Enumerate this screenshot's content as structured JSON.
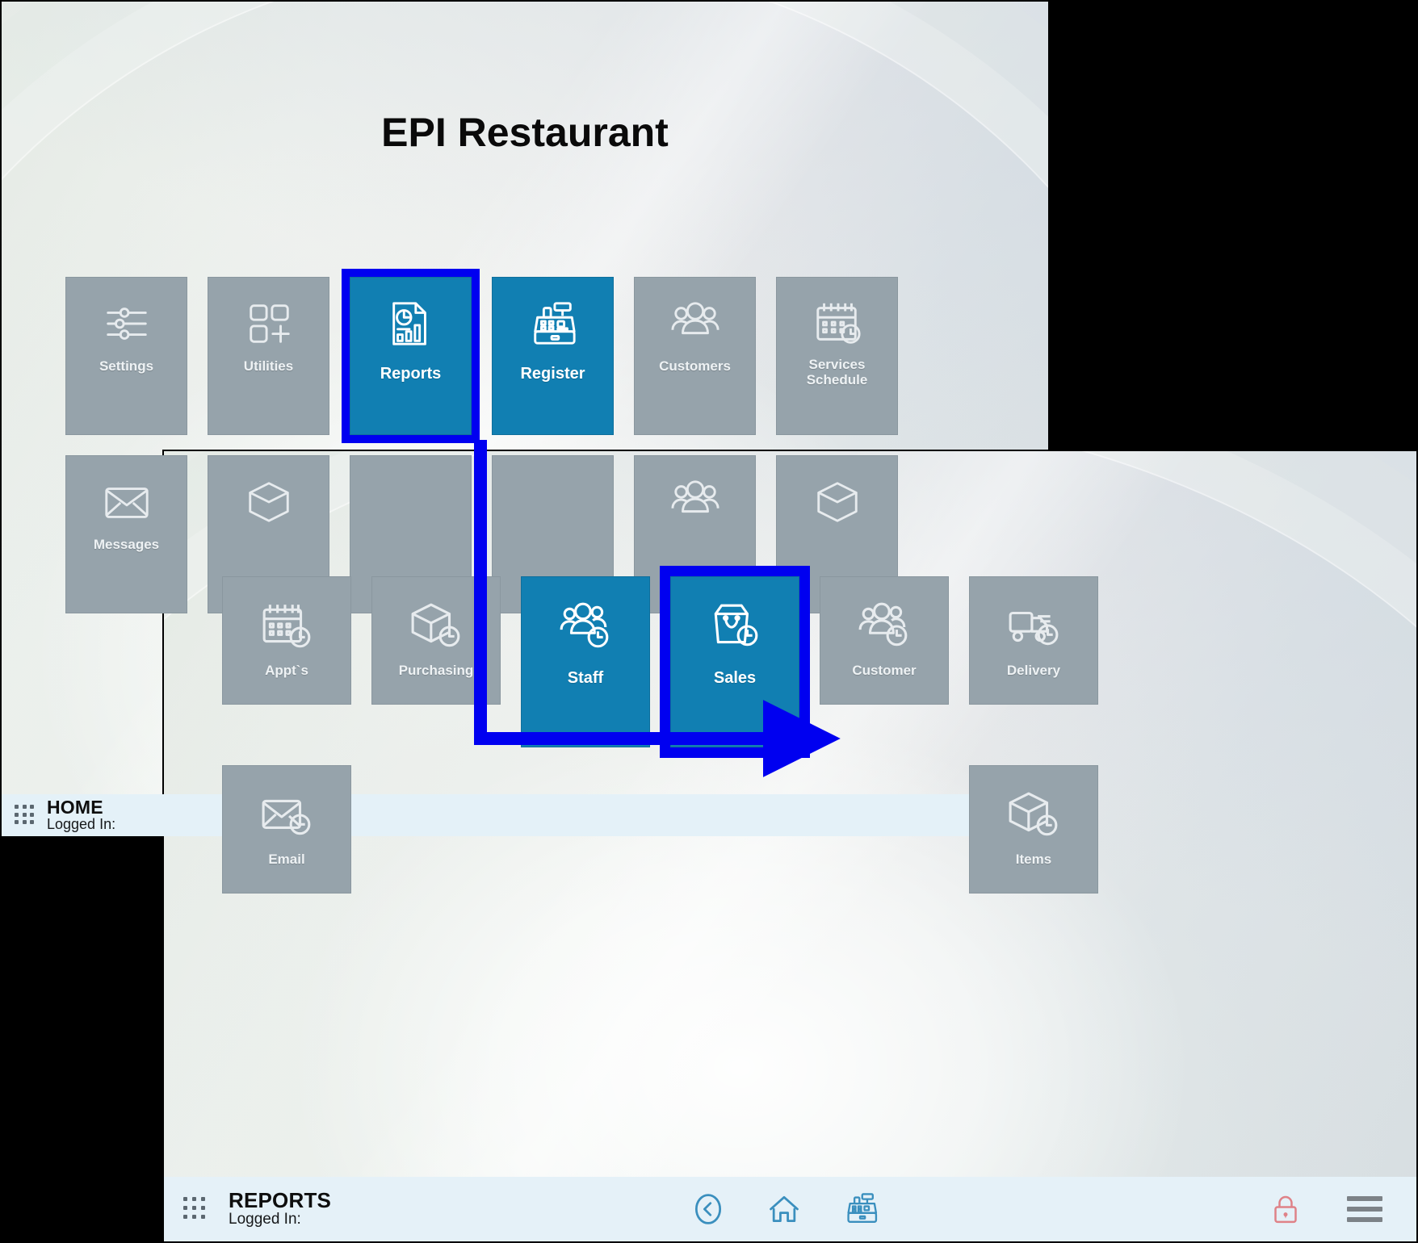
{
  "home_window": {
    "title": "EPI Restaurant",
    "tiles": [
      {
        "label": "Settings",
        "icon": "sliders-icon",
        "state": "inactive",
        "shape": "tall"
      },
      {
        "label": "Utilities",
        "icon": "grid-plus-icon",
        "state": "inactive",
        "shape": "tall"
      },
      {
        "label": "Reports",
        "icon": "report-chart-icon",
        "state": "active",
        "shape": "tall",
        "highlighted": true
      },
      {
        "label": "Register",
        "icon": "cash-register-icon",
        "state": "active",
        "shape": "tall"
      },
      {
        "label": "Customers",
        "icon": "people-group-icon",
        "state": "inactive",
        "shape": "tall"
      },
      {
        "label": "Services\nSchedule",
        "icon": "calendar-clock-icon",
        "state": "inactive",
        "shape": "tall"
      },
      {
        "label": "Messages",
        "icon": "envelope-icon",
        "state": "inactive",
        "shape": "tall"
      },
      {
        "label": "",
        "icon": "box-icon",
        "state": "inactive",
        "shape": "tall"
      },
      {
        "label": "",
        "icon": "blank-icon",
        "state": "inactive",
        "shape": "tall"
      },
      {
        "label": "",
        "icon": "blank-icon",
        "state": "inactive",
        "shape": "tall"
      },
      {
        "label": "",
        "icon": "people-group-icon",
        "state": "inactive",
        "shape": "tall"
      },
      {
        "label": "",
        "icon": "box-icon",
        "state": "inactive",
        "shape": "tall"
      }
    ],
    "footer": {
      "title": "HOME",
      "subtitle": "Logged In:",
      "grip_icon": "app-grip-icon"
    }
  },
  "reports_window": {
    "tiles": [
      {
        "label": "Appt`s",
        "icon": "calendar-clock-icon",
        "state": "inactive",
        "shape": "normal"
      },
      {
        "label": "Purchasing",
        "icon": "box-clock-icon",
        "state": "inactive",
        "shape": "normal"
      },
      {
        "label": "Staff",
        "icon": "people-clock-icon",
        "state": "active",
        "shape": "tall"
      },
      {
        "label": "Sales",
        "icon": "shopping-bag-clock-icon",
        "state": "active",
        "shape": "tall",
        "highlighted": true
      },
      {
        "label": "Customer",
        "icon": "people-clock-icon",
        "state": "inactive",
        "shape": "normal"
      },
      {
        "label": "Delivery",
        "icon": "truck-clock-icon",
        "state": "inactive",
        "shape": "normal"
      },
      {
        "label": "Email",
        "icon": "envelope-clock-icon",
        "state": "inactive",
        "shape": "normal"
      },
      {
        "label": "Items",
        "icon": "box-clock-icon",
        "state": "inactive",
        "shape": "normal"
      }
    ],
    "footer": {
      "title": "REPORTS",
      "subtitle": "Logged In:",
      "grip_icon": "app-grip-icon",
      "nav_icons": [
        "back-circle-icon",
        "home-icon",
        "cash-register-icon"
      ],
      "right_icons": [
        "lock-icon",
        "hamburger-menu-icon"
      ]
    }
  },
  "annotation": {
    "type": "flow-arrow",
    "color": "#0000f0",
    "from": "Reports",
    "to": "Sales"
  },
  "colors": {
    "tile_inactive": "#96a3ab",
    "tile_active": "#117fb2",
    "highlight": "#0000f0",
    "footer_bg": "#e4f1f8",
    "lock_icon": "#df8288",
    "nav_icon": "#3a8fbe"
  }
}
